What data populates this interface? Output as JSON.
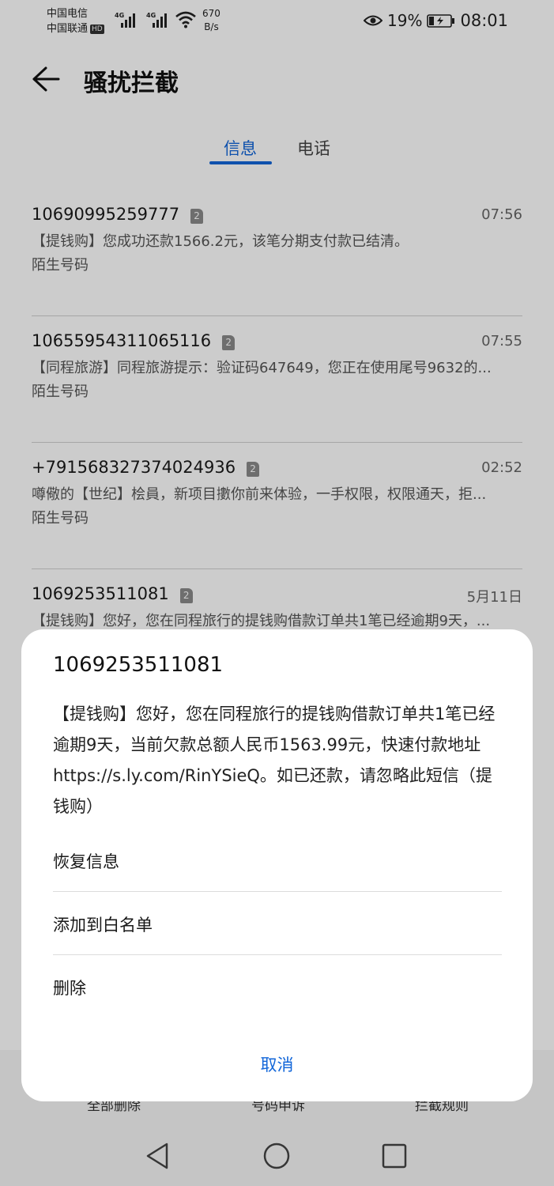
{
  "status_bar": {
    "carrier_1": "中国电信",
    "carrier_2": "中国联通",
    "hd_badge": "HD",
    "net_tag_1": "4G",
    "net_tag_2": "4G",
    "speed_value": "670",
    "speed_unit": "B/s",
    "battery": "19%",
    "time": "08:01"
  },
  "header": {
    "title": "骚扰拦截"
  },
  "tabs": [
    {
      "label": "信息",
      "active": true
    },
    {
      "label": "电话",
      "active": false
    }
  ],
  "messages": [
    {
      "sender": "10690995259777",
      "sim": "2",
      "time": "07:56",
      "preview": "【提钱购】您成功还款1566.2元，该笔分期支付款已结清。",
      "label": "陌生号码"
    },
    {
      "sender": "10655954311065116",
      "sim": "2",
      "time": "07:55",
      "preview": "【同程旅游】同程旅游提示：验证码647649，您正在使用尾号9632的...",
      "label": "陌生号码"
    },
    {
      "sender": "+791568327374024936",
      "sim": "2",
      "time": "02:52",
      "preview": "噂儆的【世纪】桧員，新项目擻你前来体验，一手权限，权限通天，拒...",
      "label": "陌生号码"
    },
    {
      "sender": "1069253511081",
      "sim": "2",
      "time": "5月11日",
      "preview": "【提钱购】您好，您在同程旅行的提钱购借款订单共1笔已经逾期9天，...",
      "label": ""
    }
  ],
  "bottom_actions": [
    "全部删除",
    "号码申诉",
    "拦截规则"
  ],
  "dialog": {
    "title": "1069253511081",
    "body": "【提钱购】您好，您在同程旅行的提钱购借款订单共1笔已经逾期9天，当前欠款总额人民币1563.99元，快速付款地址https://s.ly.com/RinYSieQ。如已还款，请忽略此短信（提钱购）",
    "options": [
      "恢复信息",
      "添加到白名单",
      "删除"
    ],
    "cancel": "取消"
  },
  "colors": {
    "accent": "#1266d9",
    "scrim": "rgba(0,0,0,0.2)"
  },
  "icons": {
    "back": "arrow-left",
    "eye": "eye-comfort",
    "battery": "battery-charging",
    "nav_back": "triangle-left",
    "nav_home": "circle",
    "nav_recents": "square"
  }
}
